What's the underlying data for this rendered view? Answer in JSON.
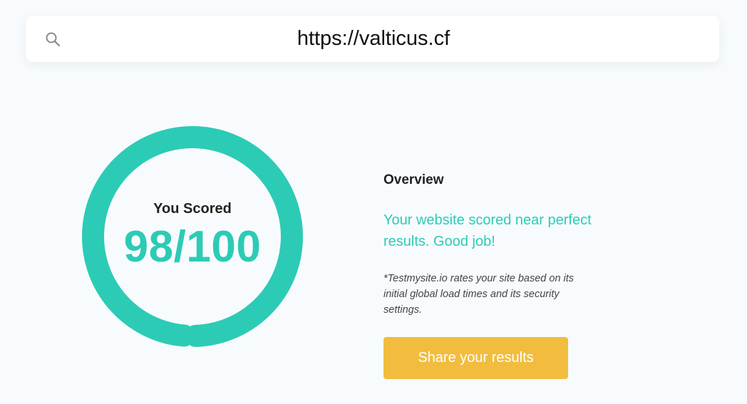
{
  "search": {
    "value": "https://valticus.cf",
    "icon": "search-icon"
  },
  "score": {
    "label": "You Scored",
    "value_text": "98/100",
    "value": 98,
    "max": 100,
    "ring_color": "#2ccbb6"
  },
  "overview": {
    "title": "Overview",
    "message": "Your website scored near perfect results. Good job!",
    "note": "*Testmysite.io rates your site based on its initial global load times and its security settings."
  },
  "share_button": {
    "label": "Share your results",
    "color": "#f2bd3e"
  },
  "colors": {
    "accent": "#2ccbb6",
    "background": "#f8fbfd"
  }
}
